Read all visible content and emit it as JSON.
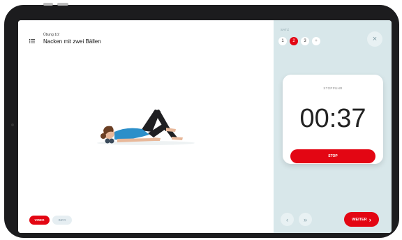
{
  "exercise": {
    "step_label": "Übung 1/2",
    "title": "Nacken mit zwei Bällen"
  },
  "mode_tabs": {
    "video_label": "VIDEO",
    "info_label": "INFO",
    "active": "VIDEO"
  },
  "sets": {
    "label": "SATZ",
    "items": [
      "1",
      "2",
      "3"
    ],
    "active_index": 1,
    "add_label": "+"
  },
  "close_label": "×",
  "stopwatch": {
    "label": "STOPPUHR",
    "time": "00:37",
    "stop_label": "STOP"
  },
  "navigation": {
    "prev_label": "‹",
    "skip_label": "»",
    "next_label": "WEITER",
    "next_arrow": "›"
  },
  "colors": {
    "accent": "#e30613",
    "panel_bg": "#d8e7ea",
    "frame": "#1c1c1e"
  }
}
